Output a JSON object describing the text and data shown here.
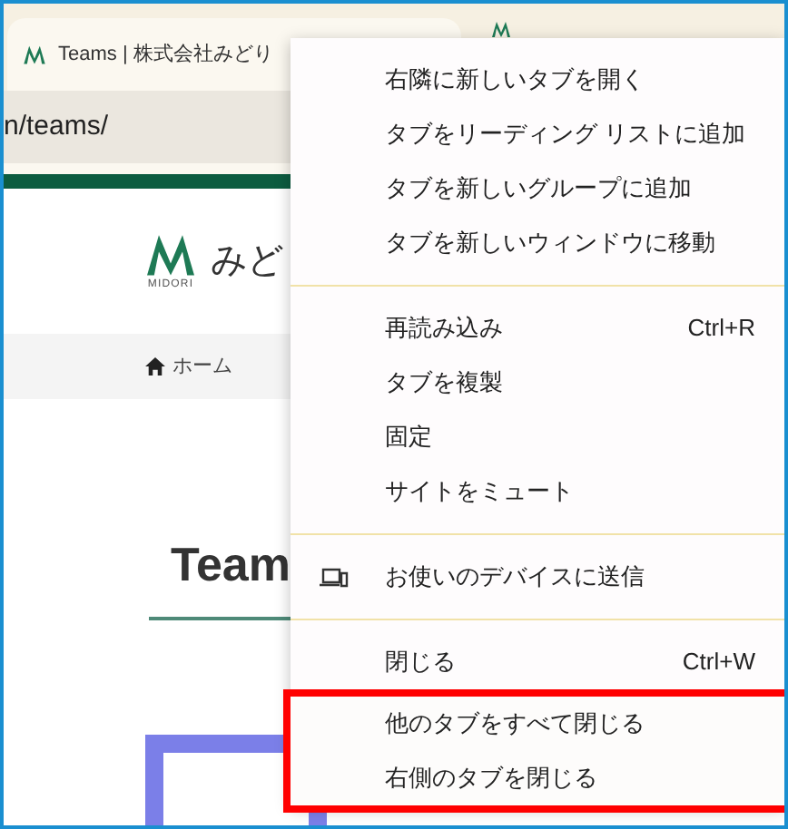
{
  "browser": {
    "active_tab": {
      "title": "Teams | 株式会社みどり"
    },
    "address": "n/teams/"
  },
  "site": {
    "logo_text": "みど",
    "logo_sub": "MIDORI",
    "breadcrumb": "ホーム",
    "heading": "Team"
  },
  "menu": {
    "groups": [
      {
        "items": [
          {
            "kind": "plain",
            "label": "右隣に新しいタブを開く",
            "highlighted": false
          },
          {
            "kind": "plain",
            "label": "タブをリーディング リストに追加",
            "highlighted": false
          },
          {
            "kind": "plain",
            "label": "タブを新しいグループに追加",
            "highlighted": false
          },
          {
            "kind": "plain",
            "label": "タブを新しいウィンドウに移動",
            "highlighted": false
          }
        ]
      },
      {
        "items": [
          {
            "kind": "plain",
            "label": "再読み込み",
            "shortcut": "Ctrl+R",
            "highlighted": false
          },
          {
            "kind": "plain",
            "label": "タブを複製",
            "highlighted": false
          },
          {
            "kind": "plain",
            "label": "固定",
            "highlighted": false
          },
          {
            "kind": "plain",
            "label": "サイトをミュート",
            "highlighted": false
          }
        ]
      },
      {
        "items": [
          {
            "kind": "device",
            "label": "お使いのデバイスに送信",
            "highlighted": false
          }
        ]
      },
      {
        "items": [
          {
            "kind": "plain",
            "label": "閉じる",
            "shortcut": "Ctrl+W",
            "highlighted": false
          },
          {
            "kind": "plain",
            "label": "他のタブをすべて閉じる",
            "highlighted": true
          },
          {
            "kind": "plain",
            "label": "右側のタブを閉じる",
            "highlighted": true
          }
        ]
      }
    ]
  }
}
